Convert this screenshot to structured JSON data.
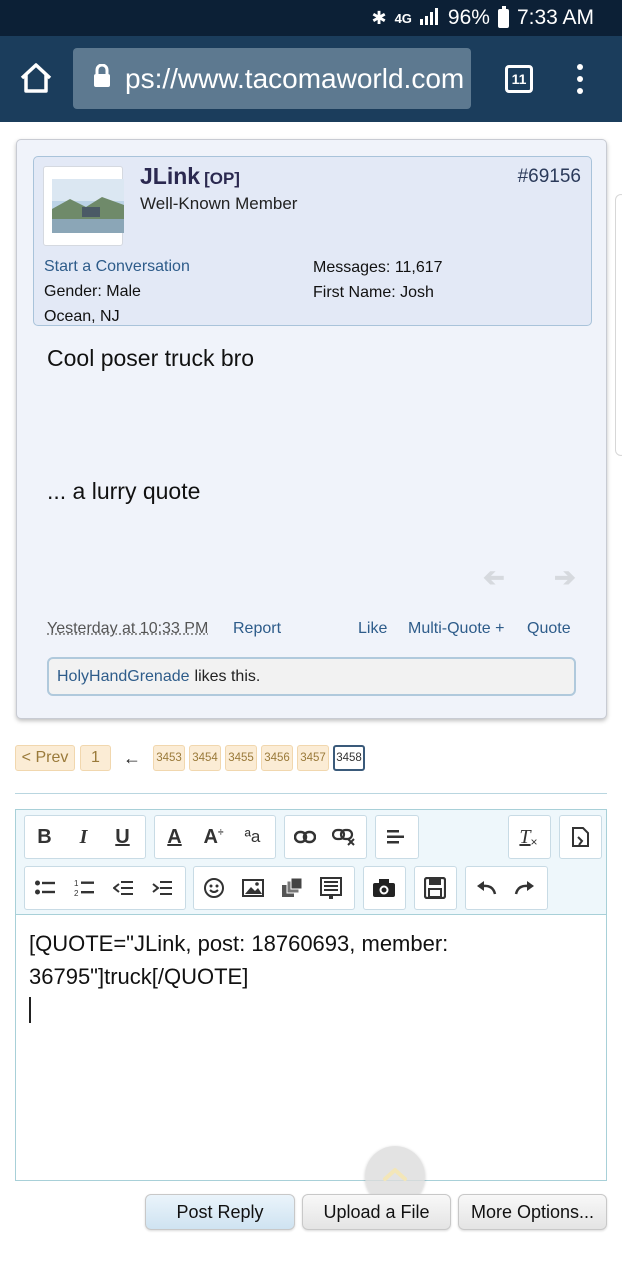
{
  "status_bar": {
    "network": "4G",
    "battery": "96%",
    "time": "7:33 AM"
  },
  "browser": {
    "url": "ps://www.tacomaworld.com",
    "tab_count": "11"
  },
  "post": {
    "username": "JLink",
    "op_tag": "[OP]",
    "user_title": "Well-Known Member",
    "post_number": "#69156",
    "start_conversation": "Start a Conversation",
    "gender": "Gender:  Male",
    "location": "Ocean, NJ",
    "messages": "Messages:  11,617",
    "first_name": "First Name:  Josh",
    "message_line1": "Cool poser truck bro",
    "message_line2": "... a lurry quote",
    "timestamp": "Yesterday at 10:33 PM",
    "report": "Report",
    "like": "Like",
    "multi_quote": "Multi-Quote +",
    "quote": "Quote",
    "liker": "HolyHandGrenade",
    "likes_suffix": "likes this."
  },
  "pagination": {
    "prev": "< Prev",
    "first": "1",
    "arrow": "←",
    "pages": [
      "3453",
      "3454",
      "3455",
      "3456",
      "3457"
    ],
    "current": "3458"
  },
  "editor": {
    "content_line1": "[QUOTE=\"JLink, post: 18760693, member:",
    "content_line2": "36795\"]truck[/QUOTE]"
  },
  "buttons": {
    "post_reply": "Post Reply",
    "upload_file": "Upload a File",
    "more_options": "More Options..."
  },
  "colors": {
    "status_bg": "#0c2036",
    "browser_bg": "#1b3d5c",
    "link": "#2e5c8a",
    "username": "#2b2950"
  }
}
